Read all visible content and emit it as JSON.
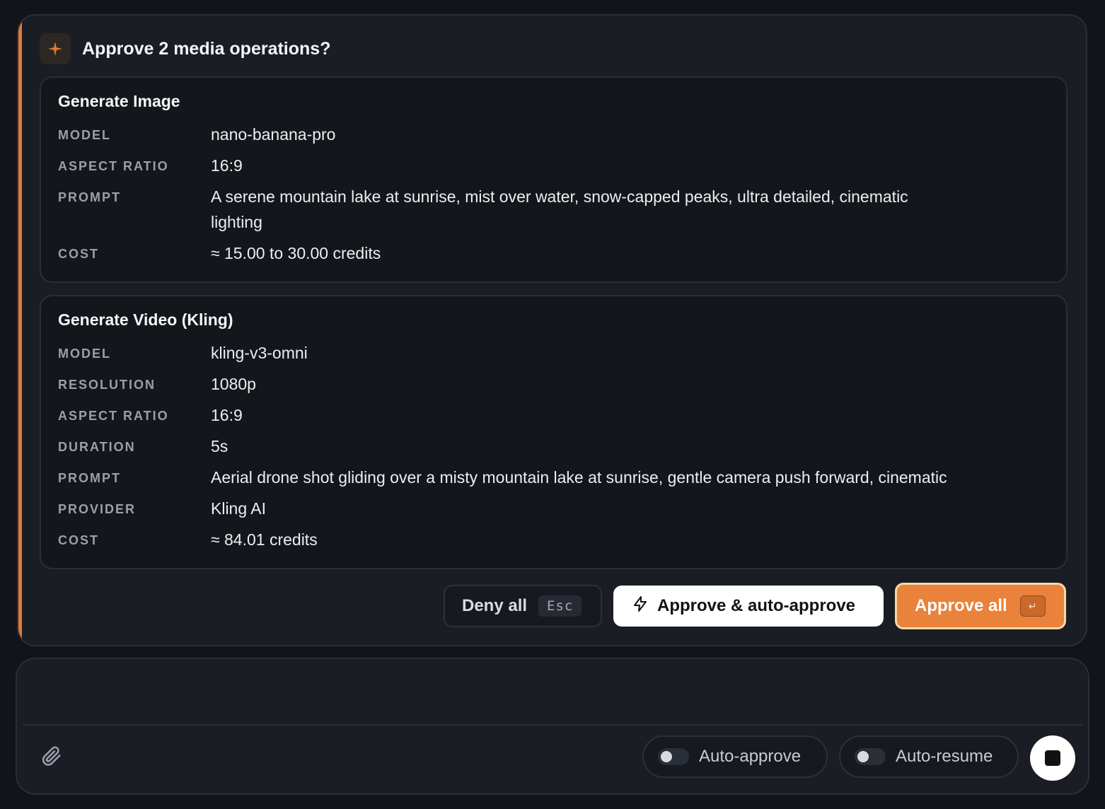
{
  "approval": {
    "title": "Approve 2 media operations?",
    "accent_color": "#e07a35",
    "operations": [
      {
        "title": "Generate Image",
        "fields": [
          {
            "key": "MODEL",
            "value": "nano-banana-pro"
          },
          {
            "key": "ASPECT RATIO",
            "value": "16:9"
          },
          {
            "key": "PROMPT",
            "value": "A serene mountain lake at sunrise, mist over water, snow-capped peaks, ultra detailed, cinematic lighting"
          },
          {
            "key": "COST",
            "value": "≈ 15.00 to 30.00 credits"
          }
        ]
      },
      {
        "title": "Generate Video (Kling)",
        "fields": [
          {
            "key": "MODEL",
            "value": "kling-v3-omni"
          },
          {
            "key": "RESOLUTION",
            "value": "1080p"
          },
          {
            "key": "ASPECT RATIO",
            "value": "16:9"
          },
          {
            "key": "DURATION",
            "value": "5s"
          },
          {
            "key": "PROMPT",
            "value": "Aerial drone shot gliding over a misty mountain lake at sunrise, gentle camera push forward, cinematic"
          },
          {
            "key": "PROVIDER",
            "value": "Kling AI"
          },
          {
            "key": "COST",
            "value": "≈ 84.01 credits"
          }
        ]
      }
    ],
    "actions": {
      "deny_label": "Deny all",
      "deny_shortcut": "Esc",
      "auto_approve_label": "Approve & auto-approve",
      "approve_all_label": "Approve all",
      "approve_all_shortcut": "↵"
    }
  },
  "composer": {
    "auto_approve_label": "Auto-approve",
    "auto_resume_label": "Auto-resume",
    "auto_approve_on": false,
    "auto_resume_on": false
  }
}
